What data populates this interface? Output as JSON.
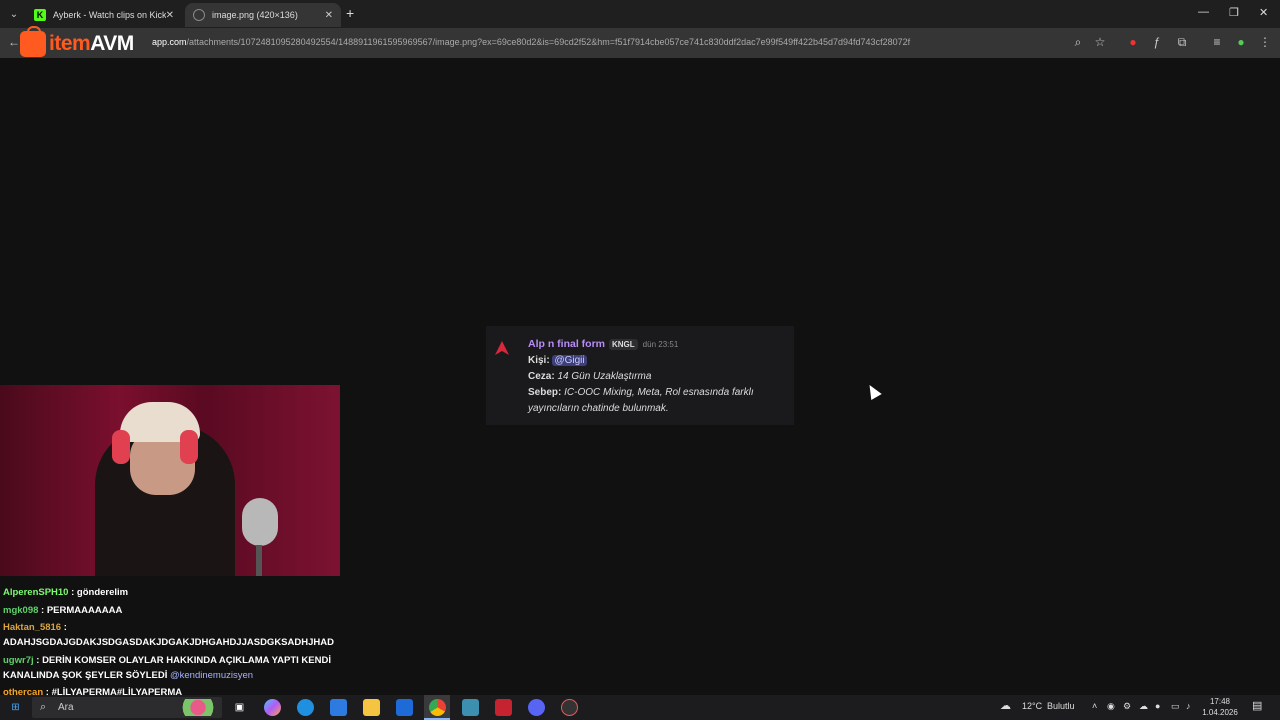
{
  "browser": {
    "tabs": [
      {
        "title": "Ayberk - Watch clips on Kick",
        "favicon_color": "#53fc18"
      },
      {
        "title": "image.png (420×136)",
        "favicon_color": "#888888"
      }
    ],
    "new_tab": "+",
    "close": "✕",
    "window_controls": {
      "minimize": "—",
      "maximize": "❐",
      "close": "✕"
    },
    "url_prefix": "",
    "url_domain": "app.com",
    "url_path": "/attachments/1072481095280492554/1488911961595969567/image.png?ex=69ce80d2&is=69cd2f52&hm=f51f7914cbe057ce741c830ddf2dac7e99f549ff422b45d7d94fd743cf28072f"
  },
  "overlay_logo": {
    "part1": "item",
    "part2": "AVM"
  },
  "message": {
    "author": "Alp n final form",
    "tag": "KNGL",
    "time": "dün 23:51",
    "person_label": "Kişi:",
    "person_value": "@Gigii",
    "penalty_label": "Ceza:",
    "penalty_value": "14 Gün Uzaklaştırma",
    "reason_label": "Sebep:",
    "reason_value_1": "IC-OOC Mixing, Meta, Rol esnasında farklı",
    "reason_value_2": "yayıncıların chatinde bulunmak."
  },
  "chat": [
    {
      "user": "AlperenSPH10",
      "text": " : gönderelim"
    },
    {
      "user": "mgk098",
      "text": " : PERMAAAAAAA"
    },
    {
      "user": "Haktan_5816",
      "text": " :"
    },
    {
      "text": "ADAHJSGDAJGDAKJSDGASDAKJDGAKJDHGAHDJJASDGKSADHJHAD"
    },
    {
      "user": "ugwr7j",
      "text": " : DERİN KOMSER OLAYLAR HAKKINDA AÇIKLAMA YAPTI KENDİ"
    },
    {
      "text": "KANALINDA ŞOK ŞEYLER SÖYLEDİ",
      "mention": "@kendinemuzisyen"
    },
    {
      "user": "othercan",
      "text": " : #LİLYAPERMA#LİLYAPERMA"
    }
  ],
  "taskbar": {
    "search_placeholder": "Ara",
    "weather_temp": "12°C",
    "weather_text": "Bulutlu",
    "time": "17:48",
    "date": "1.04.2026"
  },
  "colors": {
    "accent": "#ff5a1f",
    "author": "#b98cf7",
    "mention_bg": "#3c3f7a"
  }
}
